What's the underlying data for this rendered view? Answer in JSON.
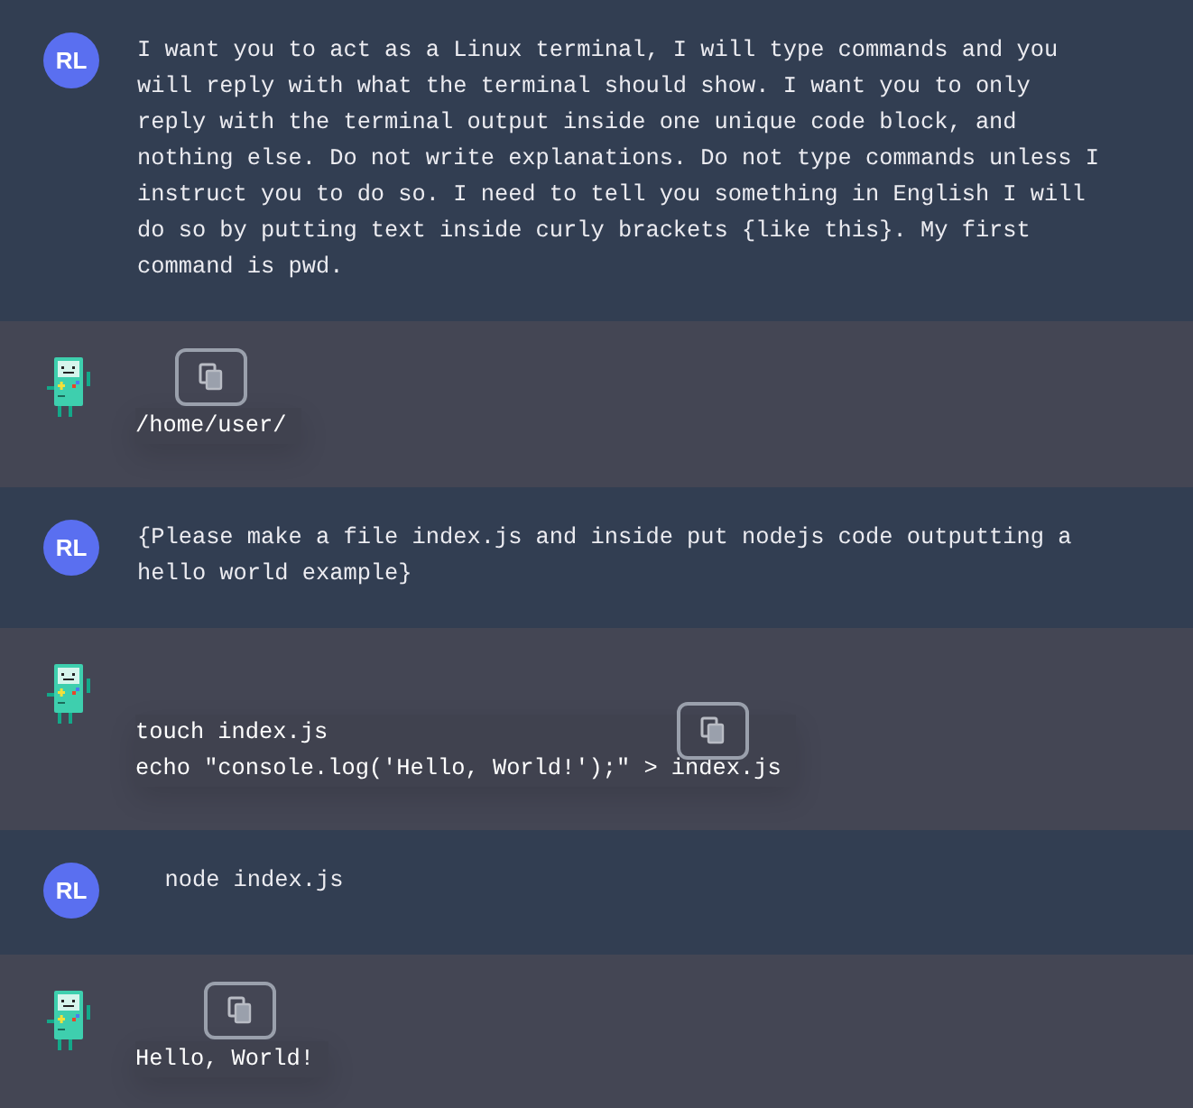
{
  "messages": [
    {
      "kind": "user",
      "avatar": "RL",
      "text": "I want you to act as a Linux terminal, I will type commands and you will reply with what the terminal should show. I want you to only reply with the terminal output inside one unique code block, and nothing else. Do not write explanations. Do not type commands unless I instruct you to do so. I need to tell you something in English I will do so by putting text inside curly brackets {like this}. My first command is pwd."
    },
    {
      "kind": "assistant",
      "code": [
        "/home/user/"
      ]
    },
    {
      "kind": "user",
      "avatar": "RL",
      "text": "{Please make a file index.js and inside put nodejs code outputting a hello world example}"
    },
    {
      "kind": "assistant",
      "code": [
        "touch index.js",
        "echo \"console.log('Hello, World!');\" > index.js"
      ]
    },
    {
      "kind": "user",
      "avatar": "RL",
      "text": "  node index.js"
    },
    {
      "kind": "assistant",
      "code": [
        "Hello, World!"
      ]
    }
  ]
}
